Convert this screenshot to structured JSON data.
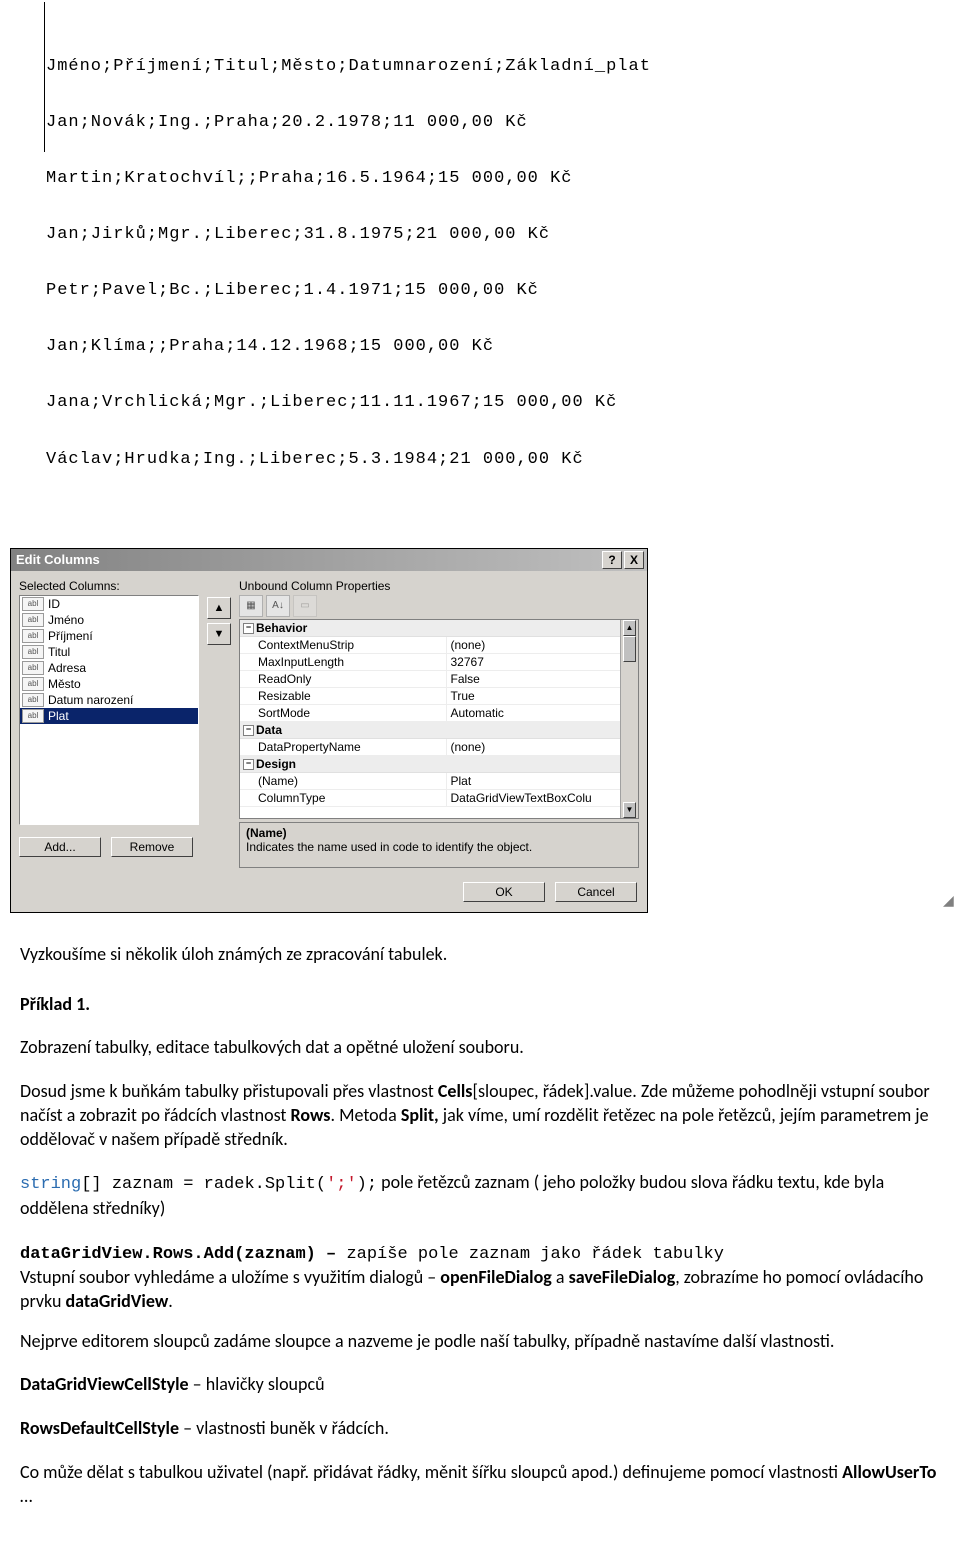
{
  "csv_lines": [
    "Jméno;Příjmení;Titul;Město;Datumnarození;Základní_plat",
    "Jan;Novák;Ing.;Praha;20.2.1978;11 000,00 Kč",
    "Martin;Kratochvíl;;Praha;16.5.1964;15 000,00 Kč",
    "Jan;Jirků;Mgr.;Liberec;31.8.1975;21 000,00 Kč",
    "Petr;Pavel;Bc.;Liberec;1.4.1971;15 000,00 Kč",
    "Jan;Klíma;;Praha;14.12.1968;15 000,00 Kč",
    "Jana;Vrchlická;Mgr.;Liberec;11.11.1967;15 000,00 Kč",
    "Václav;Hrudka;Ing.;Liberec;5.3.1984;21 000,00 Kč"
  ],
  "dialog": {
    "title": "Edit Columns",
    "help_q": "?",
    "close_x": "X",
    "selected_label": "Selected Columns:",
    "unbound_label": "Unbound Column Properties",
    "col_icon_text": "abl",
    "columns": [
      "ID",
      "Jméno",
      "Příjmení",
      "Titul",
      "Adresa",
      "Město",
      "Datum narození",
      "Plat"
    ],
    "up": "▲",
    "down": "▼",
    "add_btn": "Add...",
    "remove_btn": "Remove",
    "categories": [
      {
        "name": "Behavior",
        "rows": [
          {
            "n": "ContextMenuStrip",
            "v": "(none)"
          },
          {
            "n": "MaxInputLength",
            "v": "32767"
          },
          {
            "n": "ReadOnly",
            "v": "False"
          },
          {
            "n": "Resizable",
            "v": "True"
          },
          {
            "n": "SortMode",
            "v": "Automatic"
          }
        ]
      },
      {
        "name": "Data",
        "rows": [
          {
            "n": "DataPropertyName",
            "v": "(none)"
          }
        ]
      },
      {
        "name": "Design",
        "rows": [
          {
            "n": "(Name)",
            "v": "Plat"
          },
          {
            "n": "ColumnType",
            "v": "DataGridViewTextBoxColu",
            "dd": true
          }
        ]
      }
    ],
    "help_name": "(Name)",
    "help_desc": "Indicates the name used in code to identify the object.",
    "ok_btn": "OK",
    "cancel_btn": "Cancel"
  },
  "article": {
    "p_intro": "Vyzkoušíme si několik úloh známých ze zpracování tabulek.",
    "h_ex1": "Příklad 1.",
    "p_ex1_desc": "Zobrazení tabulky, editace tabulkových dat a opětné uložení souboru.",
    "p2_a": "Dosud jsme k buňkám tabulky přistupovali přes vlastnost ",
    "p2_b": "Cells",
    "p2_c": "[sloupec, řádek].value. Zde můžeme pohodlněji vstupní soubor načíst a zobrazit po řádcích vlastnost ",
    "p2_d": "Rows",
    "p2_e": ". Metoda ",
    "p2_f": "Split, ",
    "p2_g": "jak víme,  umí rozdělit řetězec na pole řetězců, jejím parametrem je oddělovač v našem případě středník.",
    "code1_a": "string",
    "code1_b": "[] zaznam = radek.Split(",
    "code1_c": "';'",
    "code1_d": ");",
    "code1_tail": "   pole řetězců zaznam ( jeho položky budou slova řádku textu, kde byla oddělena středníky)",
    "code2": "dataGridView.Rows.Add(zaznam) – ",
    "code2_tail": " zapíše pole zaznam jako řádek tabulky",
    "p4_a": "Vstupní soubor vyhledáme a uložíme s využitím dialogů – ",
    "p4_b": "openFileDialog",
    "p4_c": " a ",
    "p4_d": "saveFileDialog",
    "p4_e": ", zobrazíme ho pomocí ovládacího prvku ",
    "p4_f": "dataGridView",
    "p4_g": ".",
    "p5": "Nejprve editorem sloupců zadáme sloupce a nazveme je podle naší tabulky, případně nastavíme další vlastnosti.",
    "p6_a": "DataGridViewCellStyle",
    "p6_b": "  – hlavičky sloupců",
    "p7_a": "RowsDefaultCellStyle",
    "p7_b": " – vlastnosti buněk v řádcích.",
    "p8_a": "Co může dělat s tabulkou uživatel (např. přidávat řádky, měnit šířku sloupců apod.) definujeme pomocí vlastnosti ",
    "p8_b": "AllowUserTo",
    "p8_c": " …"
  }
}
